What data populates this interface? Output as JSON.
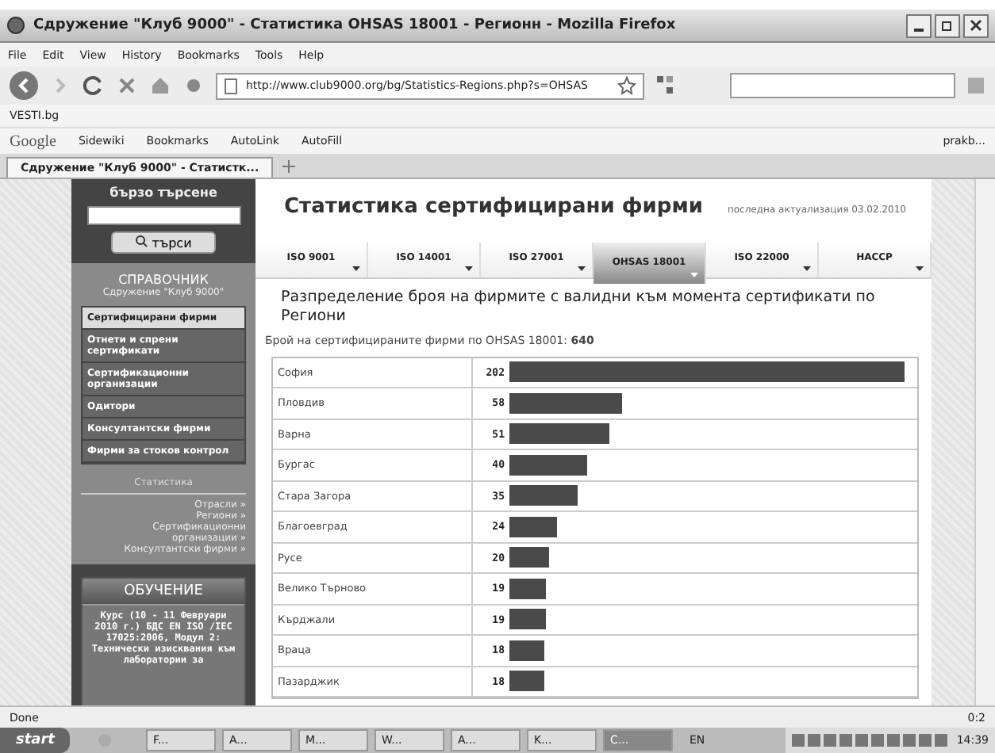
{
  "window": {
    "title": "Сдружение \"Клуб 9000\" - Статистика OHSAS 18001 - Регионн - Mozilla Firefox"
  },
  "menu": [
    "File",
    "Edit",
    "View",
    "History",
    "Bookmarks",
    "Tools",
    "Help"
  ],
  "address": {
    "value": "http://www.club9000.org/bg/Statistics-Regions.php?s=OHSAS"
  },
  "bookmarks": [
    "VESTI.bg"
  ],
  "google_toolbar": {
    "logo": "Google",
    "items": [
      "Sidewiki",
      "Bookmarks",
      "AutoLink",
      "AutoFill"
    ],
    "account": "prakb..."
  },
  "browser_tabs": [
    {
      "label": "Сдружение \"Клуб 9000\" - Статистк...",
      "selected": true
    }
  ],
  "sidebar": {
    "search_title": "бързо търсене",
    "search_button": "търси",
    "reference_title": "СПРАВОЧНИК",
    "reference_subtitle": "Сдружение \"Клуб 9000\"",
    "items": [
      {
        "label": "Сертифицирани фирми",
        "selected": true
      },
      {
        "label": "Отнети и спрени сертификати",
        "selected": false
      },
      {
        "label": "Сертификационни организации",
        "selected": false
      },
      {
        "label": "Одитори",
        "selected": false
      },
      {
        "label": "Консултантски фирми",
        "selected": false
      },
      {
        "label": "Фирми за стоков контрол",
        "selected": false
      }
    ],
    "stats_title": "Статистика",
    "stats_links": [
      "Отрасли »",
      "Региони »",
      "Сертификационни организации »",
      "Консултантски фирми »"
    ],
    "education_title": "ОБУЧЕНИЕ",
    "education_text": "Курс (10 - 11 Февруари 2010 г.) БДС EN ISO /IEC 17025:2006, Модул 2: Технически изисквания към лаборатории за"
  },
  "page": {
    "title": "Статистика сертифицирани фирми",
    "updated": "последна актуализация 03.02.2010",
    "tabs": [
      {
        "label": "ISO 9001",
        "selected": false
      },
      {
        "label": "ISO 14001",
        "selected": false
      },
      {
        "label": "ISO 27001",
        "selected": false
      },
      {
        "label": "OHSAS 18001",
        "selected": true
      },
      {
        "label": "ISO 22000",
        "selected": false
      },
      {
        "label": "HACCP",
        "selected": false
      }
    ],
    "heading": "Разпределение броя на фирмите с валидни към момента сертификати по Региони",
    "count_text": "Брой на сертифицираните фирми по OHSAS 18001: **640**",
    "rows": [
      {
        "name": "София",
        "count": "202"
      },
      {
        "name": "Пловдив",
        "count": "58"
      },
      {
        "name": "Варна",
        "count": "51"
      },
      {
        "name": "Бургас",
        "count": "40"
      },
      {
        "name": "Стара Загора",
        "count": "35"
      },
      {
        "name": "Благоевград",
        "count": "24"
      },
      {
        "name": "Русе",
        "count": "20"
      },
      {
        "name": "Велико Търново",
        "count": "19"
      },
      {
        "name": "Кърджали",
        "count": "19"
      },
      {
        "name": "Враца",
        "count": "18"
      },
      {
        "name": "Пазарджик",
        "count": "18"
      }
    ]
  },
  "status_bar": {
    "text": "Done",
    "right": "0:2"
  },
  "taskbar": {
    "start": "start",
    "items": [
      {
        "label": "F...",
        "selected": false
      },
      {
        "label": "A...",
        "selected": false
      },
      {
        "label": "M...",
        "selected": false
      },
      {
        "label": "W...",
        "selected": false
      },
      {
        "label": "A...",
        "selected": false
      },
      {
        "label": "K...",
        "selected": false
      },
      {
        "label": "C...",
        "selected": true
      }
    ],
    "language": "EN",
    "clock": "14:39"
  }
}
